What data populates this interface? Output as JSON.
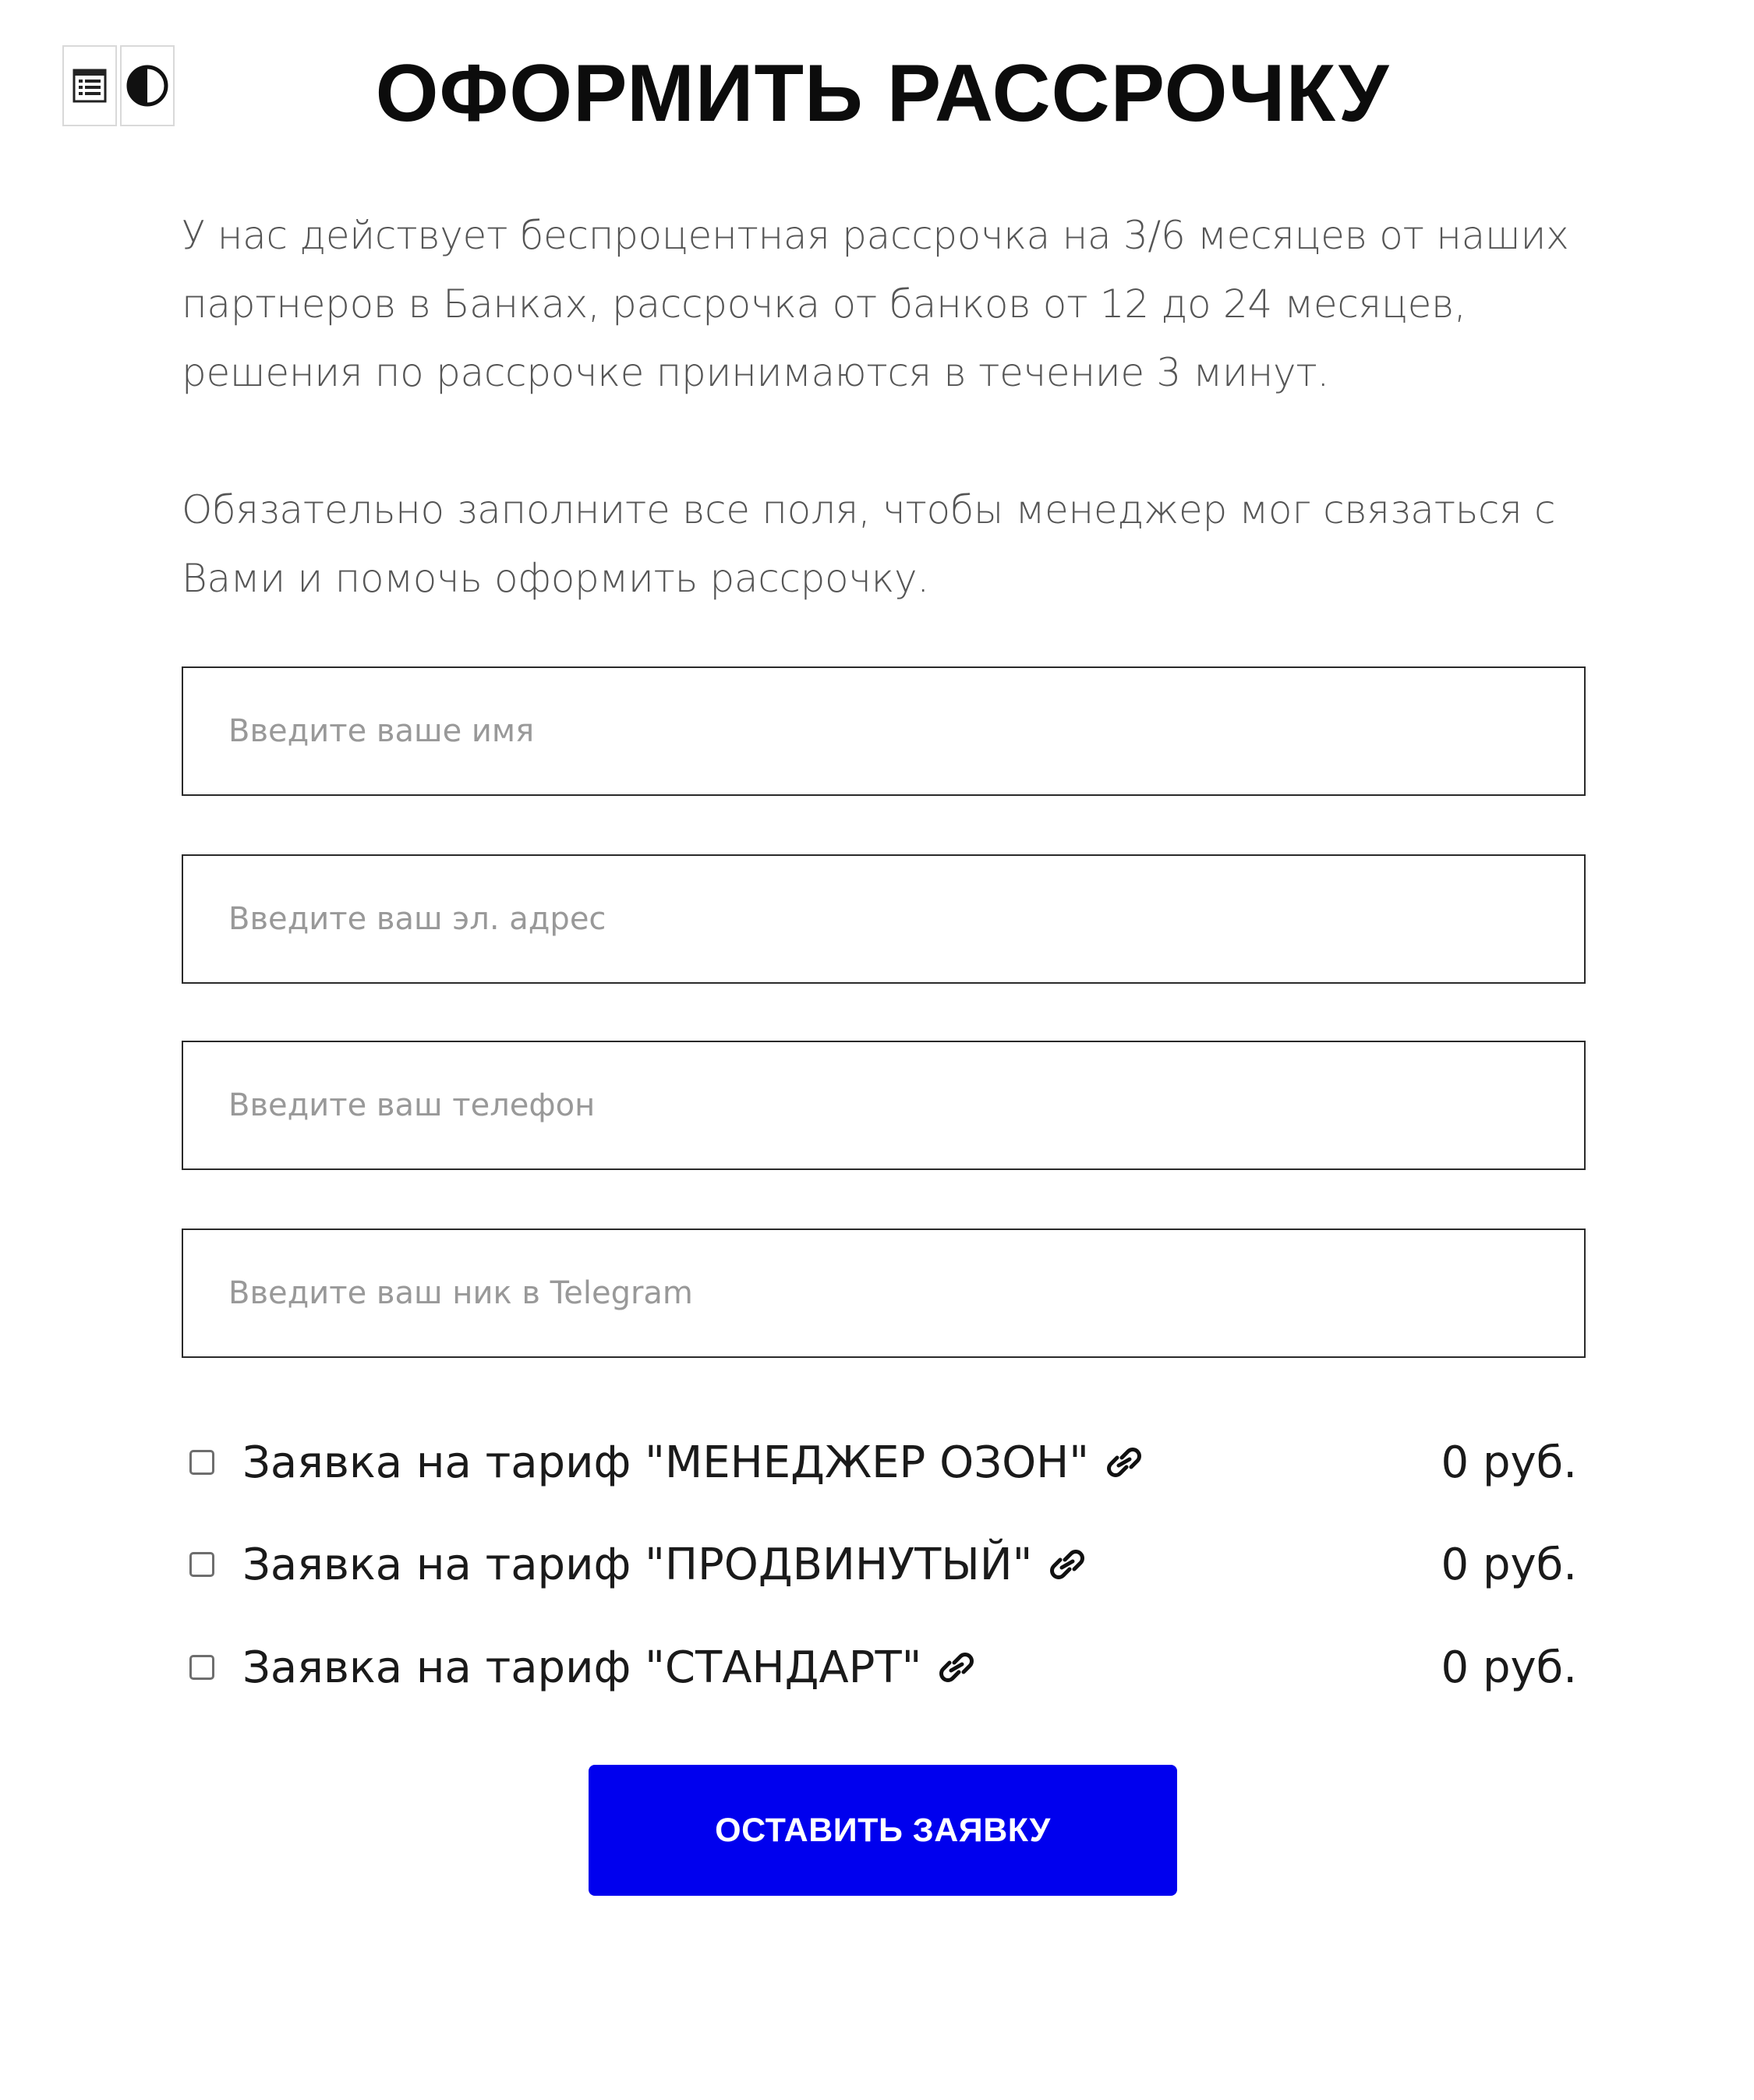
{
  "toolbar": {
    "icons": [
      "form-list-icon",
      "contrast-icon"
    ]
  },
  "title": "ОФОРМИТЬ РАССРОЧКУ",
  "intro": {
    "paragraph1": "У нас действует беспроцентная рассрочка на 3/6 месяцев от наших партнеров в Банках, рассрочка от банков от 12 до 24 месяцев, решения по рассрочке принимаются в течение 3 минут.",
    "paragraph2": "Обязательно заполните все поля, чтобы менеджер мог связаться с Вами и помочь оформить рассрочку."
  },
  "form": {
    "name_placeholder": "Введите ваше имя",
    "email_placeholder": "Введите ваш эл. адрес",
    "phone_placeholder": "Введите ваш телефон",
    "telegram_placeholder": "Введите ваш ник в Telegram",
    "name_value": "",
    "email_value": "",
    "phone_value": "",
    "telegram_value": ""
  },
  "tariffs": [
    {
      "label": "Заявка на тариф \"МЕНЕДЖЕР ОЗОН\"",
      "price": "0 руб.",
      "checked": false
    },
    {
      "label": "Заявка на тариф \"ПРОДВИНУТЫЙ\"",
      "price": "0 руб.",
      "checked": false
    },
    {
      "label": "Заявка на тариф \"СТАНДАРТ\"",
      "price": "0 руб.",
      "checked": false
    }
  ],
  "submit_label": "ОСТАВИТЬ ЗАЯВКУ",
  "colors": {
    "accent": "#0000ee",
    "text": "#111111",
    "muted_text": "#555555",
    "placeholder": "#999999"
  }
}
